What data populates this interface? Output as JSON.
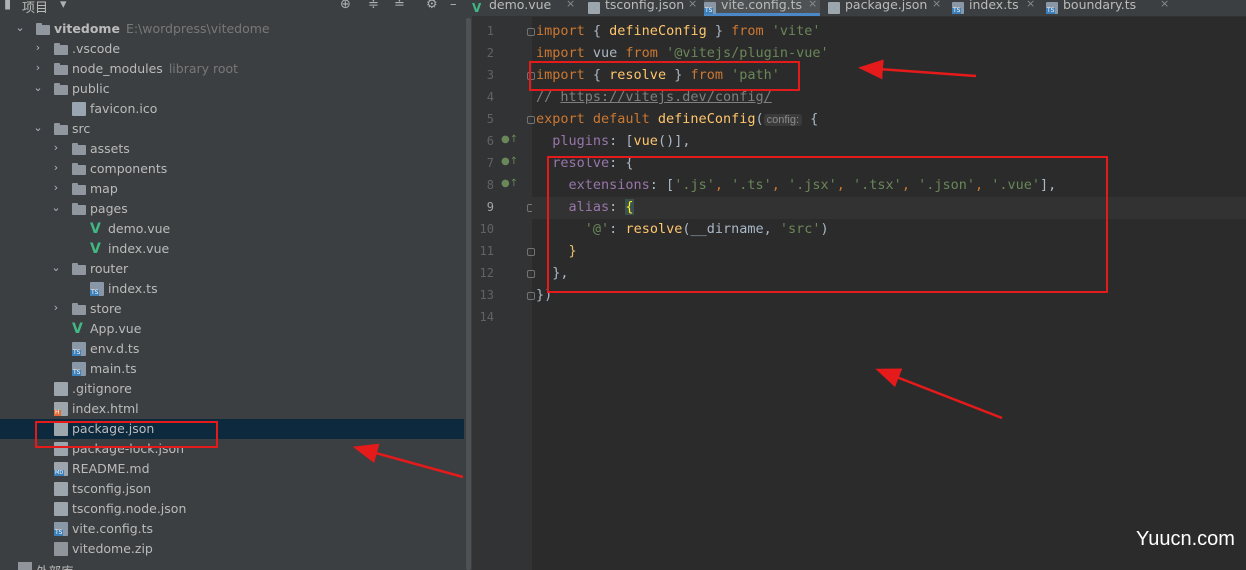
{
  "project_panel": {
    "title": "项目",
    "toolbar_icons": [
      "crosshair-icon",
      "expand-icon",
      "collapse-icon",
      "gear-icon",
      "minimize-icon"
    ],
    "tree": [
      {
        "label": "vitedome",
        "hint": "E:\\wordpress\\vitedome",
        "type": "root",
        "depth": 0,
        "expanded": true
      },
      {
        "label": ".vscode",
        "type": "folder",
        "depth": 1,
        "expanded": false
      },
      {
        "label": "node_modules",
        "hint": "library root",
        "type": "folder",
        "depth": 1,
        "expanded": false
      },
      {
        "label": "public",
        "type": "folder",
        "depth": 1,
        "expanded": true
      },
      {
        "label": "favicon.ico",
        "type": "file",
        "depth": 2
      },
      {
        "label": "src",
        "type": "folder",
        "depth": 1,
        "expanded": true
      },
      {
        "label": "assets",
        "type": "folder",
        "depth": 2,
        "expanded": false
      },
      {
        "label": "components",
        "type": "folder",
        "depth": 2,
        "expanded": false
      },
      {
        "label": "map",
        "type": "folder",
        "depth": 2,
        "expanded": false
      },
      {
        "label": "pages",
        "type": "folder",
        "depth": 2,
        "expanded": true
      },
      {
        "label": "demo.vue",
        "type": "vue",
        "depth": 3
      },
      {
        "label": "index.vue",
        "type": "vue",
        "depth": 3
      },
      {
        "label": "router",
        "type": "folder",
        "depth": 2,
        "expanded": true
      },
      {
        "label": "index.ts",
        "type": "ts",
        "depth": 3
      },
      {
        "label": "store",
        "type": "folder",
        "depth": 2,
        "expanded": false
      },
      {
        "label": "App.vue",
        "type": "vue",
        "depth": 2
      },
      {
        "label": "env.d.ts",
        "type": "ts",
        "depth": 2
      },
      {
        "label": "main.ts",
        "type": "ts",
        "depth": 2
      },
      {
        "label": ".gitignore",
        "type": "json",
        "depth": 1
      },
      {
        "label": "index.html",
        "type": "html",
        "depth": 1
      },
      {
        "label": "package.json",
        "type": "json",
        "depth": 1,
        "selected": true
      },
      {
        "label": "package-lock.json",
        "type": "json",
        "depth": 1
      },
      {
        "label": "README.md",
        "type": "md",
        "depth": 1
      },
      {
        "label": "tsconfig.json",
        "type": "json",
        "depth": 1
      },
      {
        "label": "tsconfig.node.json",
        "type": "json",
        "depth": 1
      },
      {
        "label": "vite.config.ts",
        "type": "ts",
        "depth": 1
      },
      {
        "label": "vitedome.zip",
        "type": "zip",
        "depth": 1
      },
      {
        "label": "外部库",
        "type": "lib",
        "depth": 0
      }
    ]
  },
  "tabs": [
    {
      "label": "demo.vue",
      "type": "vue"
    },
    {
      "label": "tsconfig.json",
      "type": "json"
    },
    {
      "label": "vite.config.ts",
      "type": "ts",
      "active": true
    },
    {
      "label": "package.json",
      "type": "json"
    },
    {
      "label": "index.ts",
      "type": "ts"
    },
    {
      "label": "boundary.ts",
      "type": "ts"
    }
  ],
  "editor": {
    "current_line": 9,
    "line_numbers": [
      "1",
      "2",
      "3",
      "4",
      "5",
      "6",
      "7",
      "8",
      "9",
      "10",
      "11",
      "12",
      "13",
      "14"
    ],
    "param_hint": "config:",
    "tokens": {
      "l1": [
        "import",
        " { ",
        "defineConfig",
        " } ",
        "from",
        " ",
        "'vite'"
      ],
      "l2": [
        "import",
        " vue ",
        "from",
        " ",
        "'@vitejs/plugin-vue'"
      ],
      "l3": [
        "import",
        " { ",
        "resolve",
        " } ",
        "from",
        " ",
        "'path'"
      ],
      "l4": [
        "// ",
        "https://vitejs.dev/config/"
      ],
      "l5": [
        "export default ",
        "defineConfig",
        "(",
        " {"
      ],
      "l6": [
        "  plugins",
        ": [",
        "vue",
        "()],"
      ],
      "l7": [
        "  resolve",
        ": {"
      ],
      "l8": [
        "    extensions",
        ": [",
        "'.js'",
        ", ",
        "'.ts'",
        ", ",
        "'.jsx'",
        ", ",
        "'.tsx'",
        ", ",
        "'.json'",
        ", ",
        "'.vue'",
        "],"
      ],
      "l9": [
        "    alias",
        ": ",
        "{"
      ],
      "l10": [
        "      ",
        "'@'",
        ": ",
        "resolve",
        "(__dirname, ",
        "'src'",
        ")"
      ],
      "l11": [
        "    ",
        "}"
      ],
      "l12": [
        "  },"
      ],
      "l13": [
        "})"
      ]
    }
  },
  "watermark": "Yuucn.com",
  "colors": {
    "annotation_red": "#e51a1a",
    "keyword": "#cc7832",
    "function": "#ffc66d",
    "string": "#6a8759",
    "property": "#9876aa",
    "selection": "#0d293e",
    "active_tab_underline": "#4a88c7"
  }
}
